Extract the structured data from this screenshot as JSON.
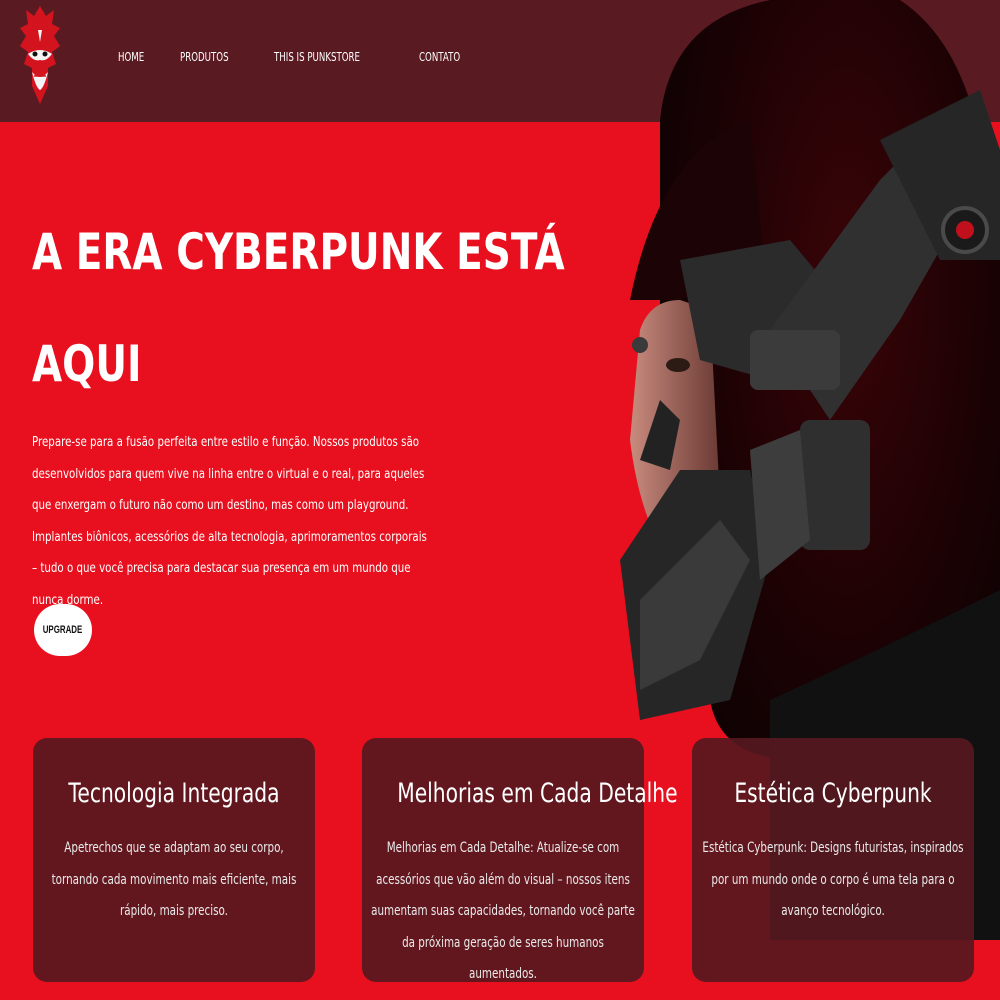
{
  "nav": {
    "items": [
      "HOME",
      "PRODUTOS",
      "THIS IS PUNKSTORE",
      "CONTATO"
    ]
  },
  "hero": {
    "title_line1": "A ERA CYBERPUNK ESTÁ",
    "title_line2": "AQUI",
    "description": "Prepare-se para a fusão perfeita entre estilo e função. Nossos produtos são desenvolvidos para quem vive na linha entre o virtual e o real, para aqueles que enxergam o futuro não como um destino, mas como um playground. Implantes biônicos, acessórios de alta tecnologia, aprimoramentos corporais – tudo o que você precisa para destacar sua presença em um mundo que nunca dorme.",
    "cta_label": "UPGRADE"
  },
  "cards": [
    {
      "title": "Tecnologia Integrada",
      "text": "Apetrechos que se adaptam ao seu corpo, tornando cada movimento mais eficiente, mais rápido, mais preciso."
    },
    {
      "title": "Melhorias em Cada Detalhe",
      "text": "Melhorias em Cada Detalhe: Atualize-se com acessórios que vão além do visual – nossos itens aumentam suas capacidades, tornando você parte da próxima geração de seres humanos aumentados."
    },
    {
      "title": "Estética Cyberpunk",
      "text": "Estética Cyberpunk: Designs futuristas, inspirados por um mundo onde o corpo é uma tela para o avanço tecnológico."
    }
  ],
  "colors": {
    "background": "#e8101e",
    "header": "#5a1a22",
    "card": "#561820",
    "button": "#ffffff"
  },
  "icons": {
    "logo": "samurai-mask-logo",
    "hero_image": "cyberpunk-woman-mask"
  }
}
